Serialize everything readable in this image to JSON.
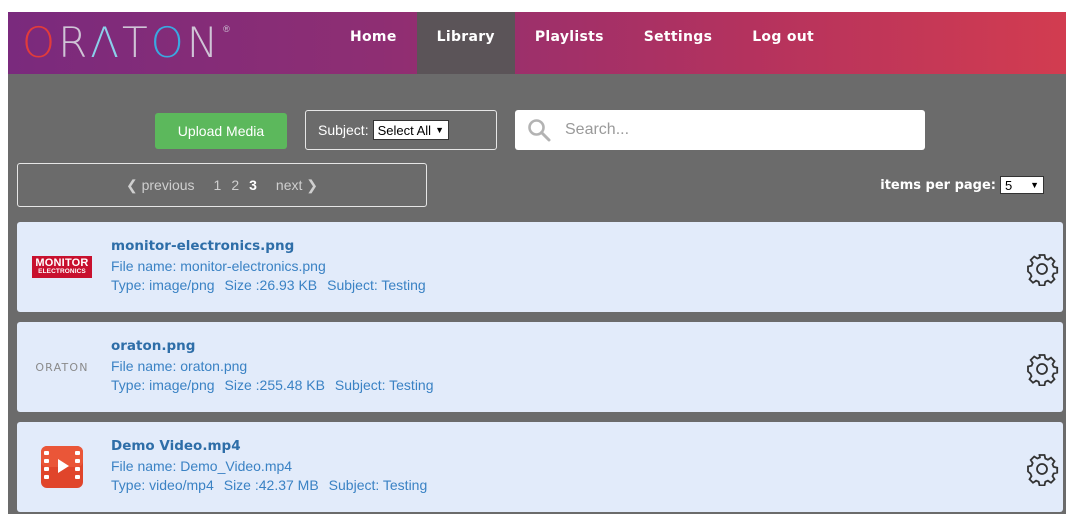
{
  "brand": {
    "logo_text": "ORATON",
    "colors": {
      "header_start": "#7a2a7d",
      "header_end": "#d23c50",
      "accent_blue": "#3a82c4",
      "upload_green": "#5cb85c",
      "panel_gray": "#6b6b6b",
      "item_bg": "#e2ebfa"
    }
  },
  "nav": {
    "items": [
      {
        "label": "Home"
      },
      {
        "label": "Library"
      },
      {
        "label": "Playlists"
      },
      {
        "label": "Settings"
      },
      {
        "label": "Log out"
      }
    ],
    "active": "Library"
  },
  "toolbar": {
    "upload_label": "Upload Media",
    "subject_label": "Subject:",
    "subject_value": "Select All",
    "search_placeholder": "Search...",
    "search_icon": "search-icon"
  },
  "pagination": {
    "previous_label": "❮ previous",
    "pages": [
      "1",
      "2",
      "3"
    ],
    "current_page": "3",
    "next_label": "next ❯",
    "items_per_page_label": "items per page:",
    "items_per_page_value": "5"
  },
  "media": [
    {
      "title": "monitor-electronics.png",
      "file_name": "File name: monitor-electronics.png",
      "type": "Type: image/png",
      "size": "Size :26.93 KB",
      "subject": "Subject: Testing",
      "thumb_text_1": "MONITOR",
      "thumb_text_2": "ELECTRONICS",
      "thumb_icon": "monitor-electronics-logo"
    },
    {
      "title": "oraton.png",
      "file_name": "File name: oraton.png",
      "type": "Type: image/png",
      "size": "Size :255.48 KB",
      "subject": "Subject: Testing",
      "thumb_text_1": "ORATON",
      "thumb_icon": "oraton-logo"
    },
    {
      "title": "Demo Video.mp4",
      "file_name": "File name: Demo_Video.mp4",
      "type": "Type: video/mp4",
      "size": "Size :42.37 MB",
      "subject": "Subject: Testing",
      "thumb_icon": "video-file-icon"
    }
  ]
}
